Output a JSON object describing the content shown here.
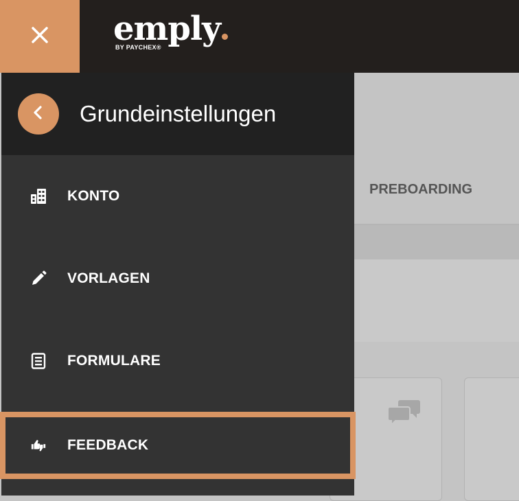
{
  "colors": {
    "accent": "#d99563",
    "topbar": "#231f1d",
    "drawer": "#333333",
    "drawer_header": "#212121"
  },
  "header": {
    "close_icon": "close-icon",
    "logo_text": "emply",
    "logo_subtext": "BY PAYCHEX®"
  },
  "drawer": {
    "back_icon": "chevron-left-icon",
    "title": "Grundeinstellungen",
    "items": [
      {
        "label": "KONTO",
        "icon": "building-icon"
      },
      {
        "label": "VORLAGEN",
        "icon": "pencil-icon"
      },
      {
        "label": "FORMULARE",
        "icon": "form-icon"
      },
      {
        "label": "FEEDBACK",
        "icon": "thumbs-feedback-icon"
      }
    ]
  },
  "background": {
    "tab_label": "PREBOARDING",
    "card_icon": "chat-bubbles-icon"
  }
}
